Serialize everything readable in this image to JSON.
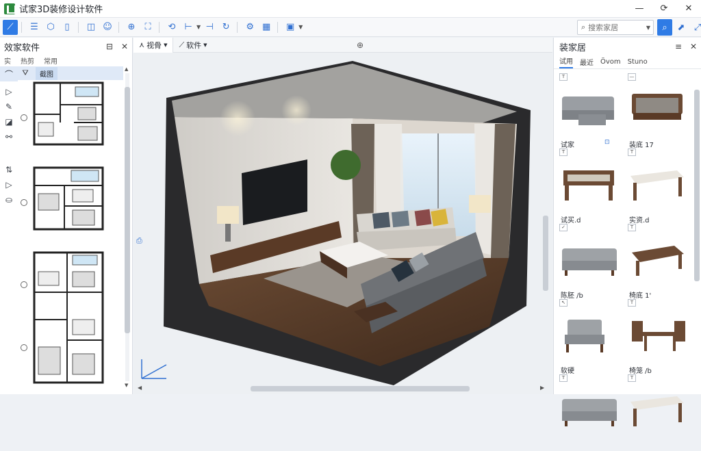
{
  "app": {
    "title": "试家3D装修设计软件"
  },
  "window_controls": {
    "minimize": "—",
    "restore": "⟳",
    "close": "✕"
  },
  "search": {
    "placeholder": "搜索家居"
  },
  "left_panel": {
    "title": "效家软件",
    "tabs": [
      "实",
      "热剪",
      "常用"
    ],
    "subbar_label": "截图"
  },
  "viewport": {
    "tabs": [
      {
        "label": "视骨"
      },
      {
        "label": "软件"
      }
    ]
  },
  "right_panel": {
    "title": "装家居",
    "tabs": [
      "试用",
      "最近",
      "Övom",
      "Stuno"
    ],
    "items": [
      {
        "label": "试家",
        "extra": "⊡",
        "flag": "T",
        "kind": "sofa-set",
        "color": "#9a9ea3"
      },
      {
        "label": "装底 17",
        "extra": "",
        "flag": "—",
        "kind": "sofa-wood",
        "color": "#8f8a84"
      },
      {
        "label": "试买.d",
        "extra": "",
        "flag": "T",
        "kind": "bench",
        "color": "#6b4a34"
      },
      {
        "label": "实资.d",
        "extra": "",
        "flag": "T",
        "kind": "table",
        "color": "#6b4a34"
      },
      {
        "label": "陈胚 /b",
        "extra": "",
        "flag": "✓",
        "kind": "sofa-3",
        "color": "#9ea2a6"
      },
      {
        "label": "椅底 1'",
        "extra": "",
        "flag": "T",
        "kind": "coffee",
        "color": "#6b4a34"
      },
      {
        "label": "软硬",
        "extra": "",
        "flag": "↖",
        "kind": "armchair",
        "color": "#9ea2a6"
      },
      {
        "label": "椅笼 /b",
        "extra": "",
        "flag": "T",
        "kind": "dining",
        "color": "#6b4a34"
      },
      {
        "label": "",
        "extra": "",
        "flag": "T",
        "kind": "sofa-3",
        "color": "#9ea2a6"
      },
      {
        "label": "",
        "extra": "",
        "flag": "T",
        "kind": "table",
        "color": "#6b4a34"
      }
    ]
  }
}
